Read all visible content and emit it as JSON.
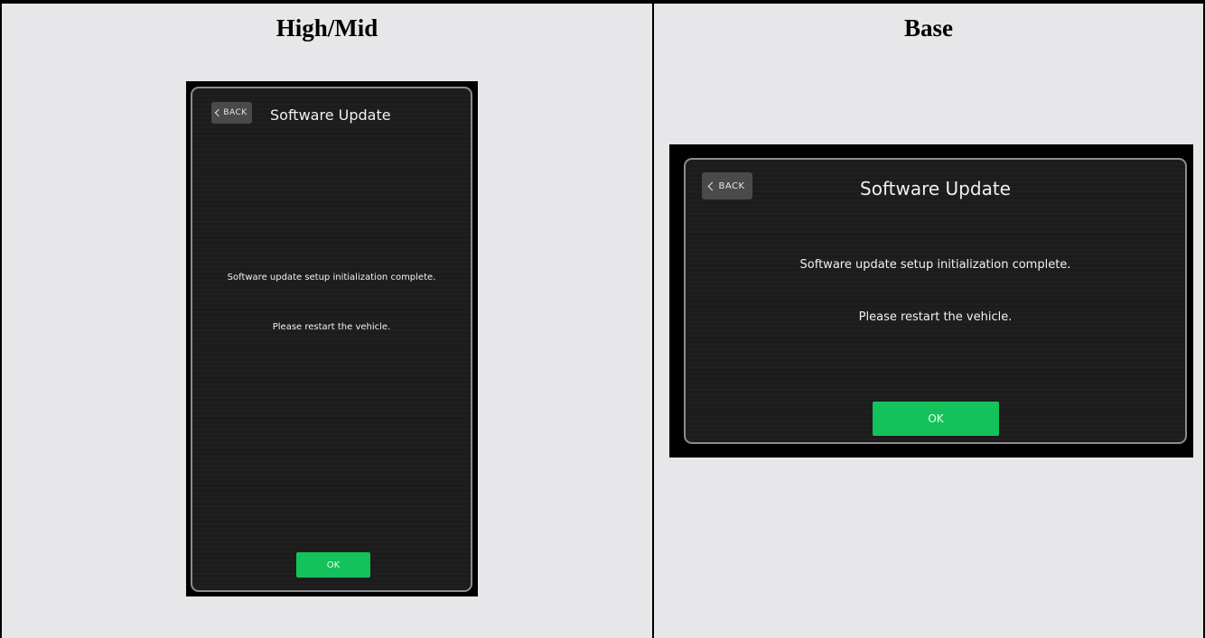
{
  "columns": [
    {
      "title": "High/Mid",
      "screen": {
        "back_label": "BACK",
        "title": "Software Update",
        "message_1": "Software update setup initialization complete.",
        "message_2": "Please restart the vehicle.",
        "ok_label": "OK"
      }
    },
    {
      "title": "Base",
      "screen": {
        "back_label": "BACK",
        "title": "Software Update",
        "message_1": "Software update setup initialization complete.",
        "message_2": "Please restart the vehicle.",
        "ok_label": "OK"
      }
    }
  ],
  "colors": {
    "ok_green": "#13c25a",
    "screen_background": "#1c1c1c",
    "page_background": "#e7e7e9"
  },
  "icons": {
    "back": "chevron-left-icon"
  }
}
